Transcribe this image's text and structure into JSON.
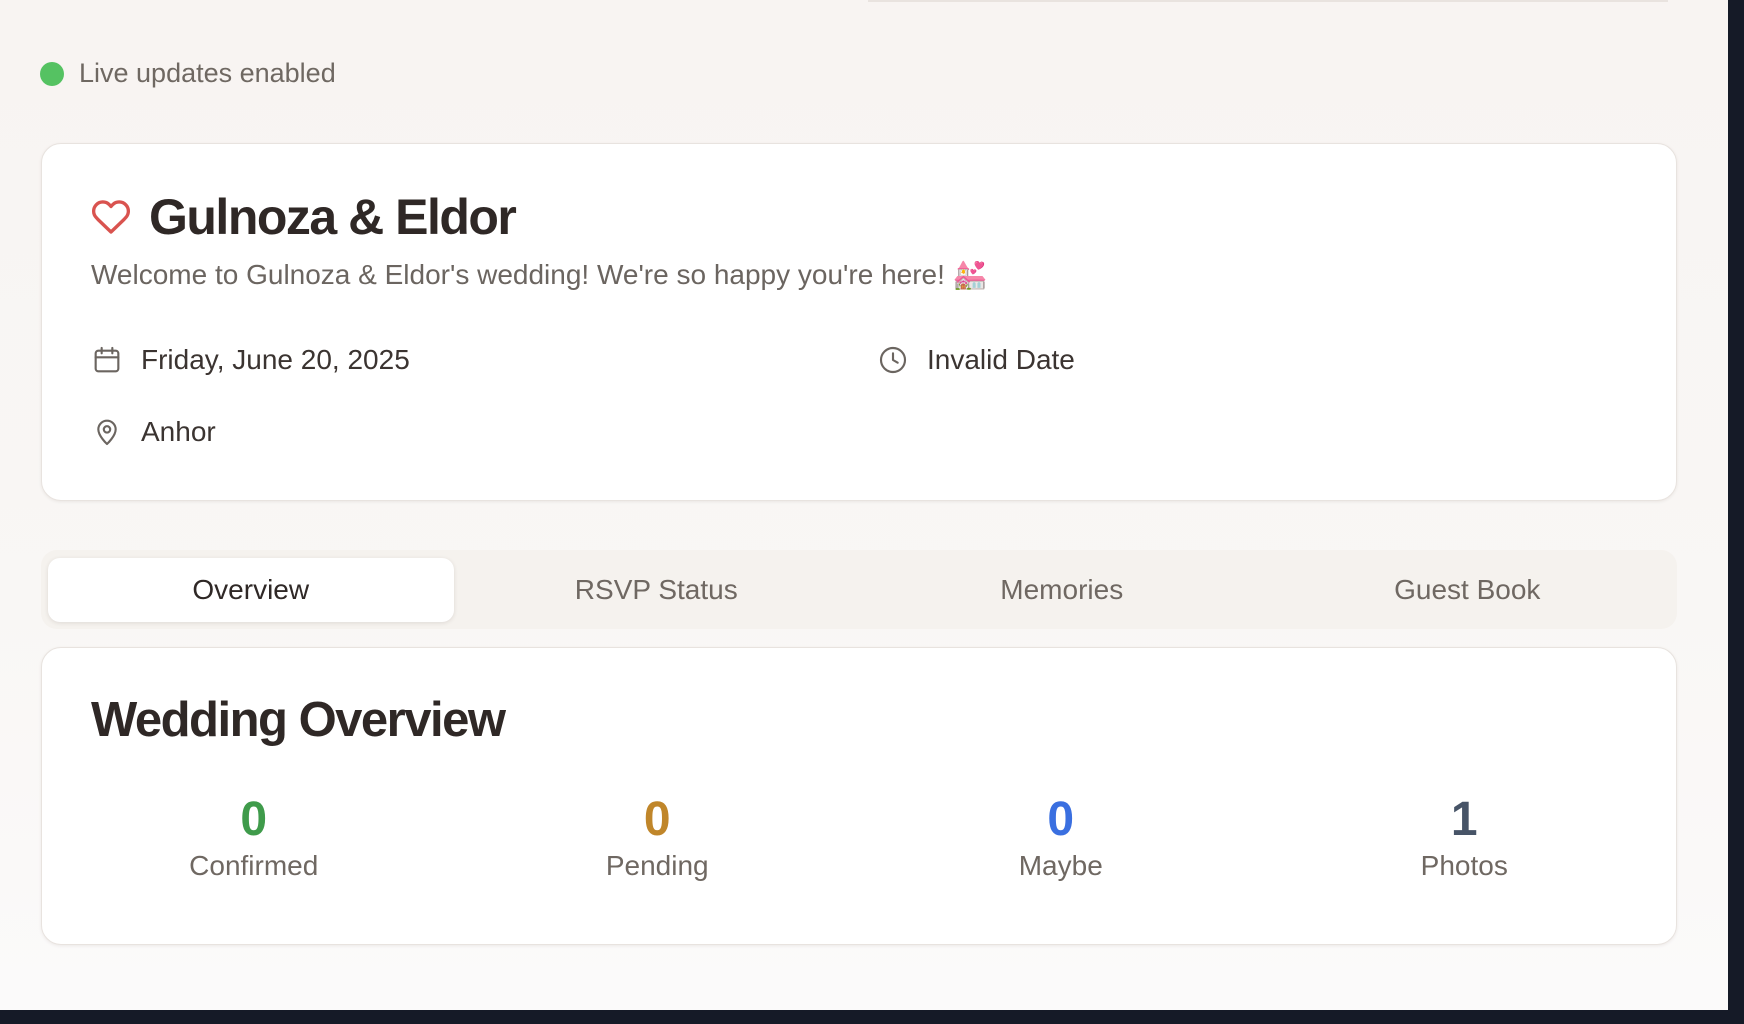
{
  "status": {
    "text": "Live updates enabled",
    "dot_color": "#55c262"
  },
  "event": {
    "title": "Gulnoza & Eldor",
    "welcome": "Welcome to Gulnoza & Eldor's wedding! We're so happy you're here!",
    "welcome_emoji": "💒",
    "date": "Friday, June 20, 2025",
    "time": "Invalid Date",
    "venue": "Anhor",
    "icons": {
      "title": "heart-icon",
      "date": "calendar-icon",
      "time": "clock-icon",
      "venue": "map-pin-icon"
    }
  },
  "tabs": [
    {
      "label": "Overview",
      "active": true
    },
    {
      "label": "RSVP Status",
      "active": false
    },
    {
      "label": "Memories",
      "active": false
    },
    {
      "label": "Guest Book",
      "active": false
    }
  ],
  "overview": {
    "title": "Wedding Overview",
    "stats": [
      {
        "value": "0",
        "label": "Confirmed",
        "color": "#3f9b4b"
      },
      {
        "value": "0",
        "label": "Pending",
        "color": "#c0862a"
      },
      {
        "value": "0",
        "label": "Maybe",
        "color": "#3a6fe0"
      },
      {
        "value": "1",
        "label": "Photos",
        "color": "#475467"
      }
    ]
  }
}
